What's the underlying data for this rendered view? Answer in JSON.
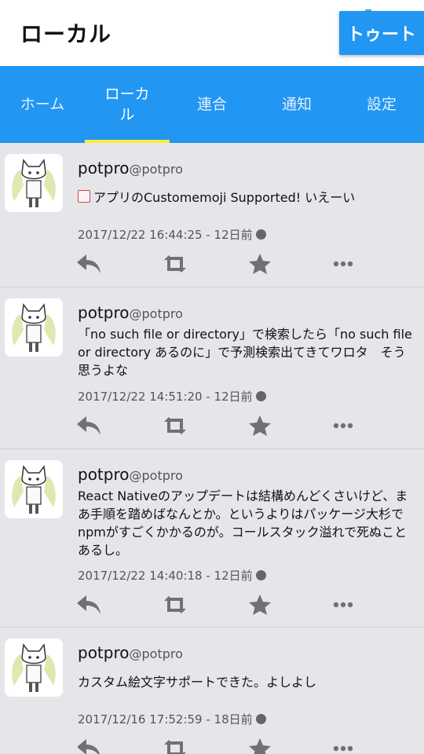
{
  "header": {
    "title": "ローカル",
    "status_fragment": "Q 7  14%",
    "toot_button": "トゥート"
  },
  "tabs": [
    {
      "label": "ホーム",
      "active": false
    },
    {
      "label": "ローカ\nル",
      "active": true
    },
    {
      "label": "連合",
      "active": false
    },
    {
      "label": "通知",
      "active": false
    },
    {
      "label": "設定",
      "active": false
    }
  ],
  "colors": {
    "accent": "#2196f3",
    "indicator": "#ffeb3b",
    "background": "#e6e6ea"
  },
  "posts": [
    {
      "name": "potpro",
      "handle": "@potpro",
      "has_custom_emoji": true,
      "text": "アプリのCustomemoji Supported! いえーい",
      "timestamp": "2017/12/22 16:44:25 - 12日前"
    },
    {
      "name": "potpro",
      "handle": "@potpro",
      "has_custom_emoji": false,
      "text": "「no such file or directory」で検索したら「no such file or directory あるのに」で予測検索出てきてワロタ　そう思うよな",
      "timestamp": "2017/12/22 14:51:20 - 12日前"
    },
    {
      "name": "potpro",
      "handle": "@potpro",
      "has_custom_emoji": false,
      "text": "React Nativeのアップデートは結構めんどくさいけど、まあ手順を踏めばなんとか。というよりはパッケージ大杉でnpmがすごくかかるのが。コールスタック溢れで死ぬことあるし。",
      "timestamp": "2017/12/22 14:40:18 - 12日前"
    },
    {
      "name": "potpro",
      "handle": "@potpro",
      "has_custom_emoji": false,
      "text": "カスタム絵文字サポートできた。よしよし",
      "timestamp": "2017/12/16 17:52:59 - 18日前"
    }
  ],
  "icons": {
    "reply": "reply-icon",
    "boost": "boost-icon",
    "favourite": "star-icon",
    "more": "more-icon",
    "visibility": "globe-icon"
  }
}
